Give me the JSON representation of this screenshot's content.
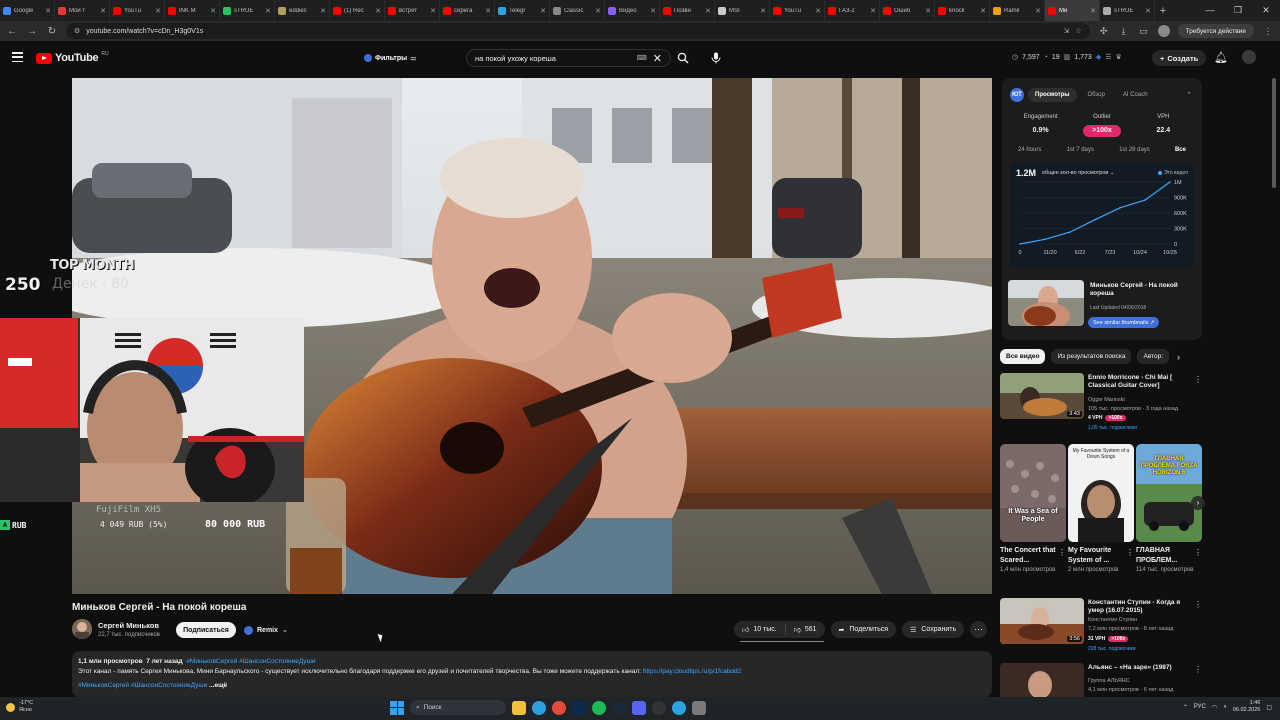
{
  "browser": {
    "tabs": [
      {
        "label": "Google",
        "color": "#4285f4"
      },
      {
        "label": "Мои т",
        "color": "#e53935"
      },
      {
        "label": "YouTu",
        "color": "#ff0000"
      },
      {
        "label": "INK M",
        "color": "#ff0000"
      },
      {
        "label": "sTRUE",
        "color": "#22c55e"
      },
      {
        "label": "eddies",
        "color": "#b0a060"
      },
      {
        "label": "(1) Rec",
        "color": "#ff0000"
      },
      {
        "label": "встрет",
        "color": "#ff0000"
      },
      {
        "label": "серега",
        "color": "#ff0000"
      },
      {
        "label": "Telegr",
        "color": "#2aa3e0"
      },
      {
        "label": "Classic",
        "color": "#888888"
      },
      {
        "label": "Видео",
        "color": "#8b5cf6"
      },
      {
        "label": "Позвн",
        "color": "#ff0000"
      },
      {
        "label": "MSI",
        "color": "#cccccc"
      },
      {
        "label": "YouTu",
        "color": "#ff0000"
      },
      {
        "label": "ГАЗ-2",
        "color": "#ff0000"
      },
      {
        "label": "Ошиб",
        "color": "#ff0000"
      },
      {
        "label": "knock",
        "color": "#ff0000"
      },
      {
        "label": "Ramil",
        "color": "#f59e0b"
      },
      {
        "label": "Ми",
        "color": "#ff0000",
        "active": true
      },
      {
        "label": "sTRUE",
        "color": "#aaaaaa"
      }
    ],
    "url": "youtube.com/watch?v=cDn_H3g0V1s",
    "update_label": "Требуется действие"
  },
  "header": {
    "logo": "YouTube",
    "logo_country": "RU",
    "filters_label": "Фильтры",
    "search_query": "на покой ухожу кореша",
    "stats": [
      "7,597",
      "19",
      "1,773"
    ],
    "create_label": "Создать"
  },
  "overlay": {
    "top_month": "TOP MONTH",
    "count": "250",
    "faded": "Денек · 80",
    "camera_text": "FujiFilm XH5",
    "rub_left": "RUB",
    "rub_pct": "4 049 RUB (5%)",
    "goal": "80 000 RUB"
  },
  "video": {
    "title": "Миньков Сергей - На покой кореша",
    "channel": "Сергей Миньков",
    "subs": "22,7 тыс. подписчиков",
    "subscribe_label": "Подписаться",
    "remix_label": "Remix",
    "likes": "10 тыс.",
    "dislikes": "561",
    "share_label": "Поделиться",
    "save_label": "Сохранить"
  },
  "description": {
    "views": "1,1 млн просмотров",
    "age": "7 лет назад",
    "hashtags": "#МиньковСергей #ШансонСостояниеДуши",
    "text": "Этот канал - память Сергея Минькова, Мини Барнаульского - существует исключительно благодаря поддержке его друзей и почитателей творчества. Вы тоже можете поддержать канал:",
    "link": "https://pay.cloudtips.ru/p/1fcabdd2",
    "hashtags2": "#МиньковСергей #ШансонСостояниеДуши",
    "more": "...ещё"
  },
  "extension": {
    "logo": "ЮТ",
    "tabs": [
      "Просмотры",
      "Обзор",
      "AI Coach"
    ],
    "metrics": [
      {
        "label": "Engagement",
        "value": "0.9%"
      },
      {
        "label": "Outlier",
        "value": ">100x"
      },
      {
        "label": "VPH",
        "value": "22.4"
      }
    ],
    "periods": [
      "24 hours",
      "1st 7 days",
      "1st 28 days",
      "Все"
    ],
    "total": "1.2M",
    "selector": "общее кол-во просмотров ⌄",
    "legend": "Это видео",
    "video_title": "Миньков Сергей - На покой кореша",
    "last_updated": "Last Updated 04/06/2018",
    "similar_btn": "See similar thumbnails ↗"
  },
  "chart_data": {
    "type": "line",
    "x": [
      "0",
      "11/20",
      "6/22",
      "7/23",
      "10/24",
      "10/25"
    ],
    "y_ticks": [
      "1M",
      "900K",
      "600K",
      "300K",
      "0"
    ],
    "values": [
      0,
      90,
      230,
      470,
      700,
      850,
      1200
    ],
    "series": [
      {
        "name": "Это видео",
        "values": [
          0,
          90,
          230,
          470,
          700,
          850,
          1200
        ]
      }
    ],
    "ylim": [
      0,
      1200
    ],
    "color": "#3ea6ff"
  },
  "related": {
    "chips": [
      "Все видео",
      "Из результатов поиска",
      "Автор: "
    ],
    "items": [
      {
        "title": "Ennio Morricone - Chi Mai [ Classical Guitar Cover]",
        "channel": "Oggie Marinski",
        "meta": "105 тыс. просмотров · 3 года назад",
        "vph": "4 VPH",
        "outlier": ">100x",
        "subs": "1,05 тыс. подписчики",
        "dur": "3:43"
      },
      {
        "title": "Константин Ступин - Когда я умер (16.07.2015)",
        "channel": "Константин Ступин",
        "meta": "7,2 млн просмотров · 8 лет назад",
        "vph": "31 VPH",
        "outlier": ">100x",
        "subs": "228 тыс. подписчики",
        "dur": "3:56"
      },
      {
        "title": "Альянс – «На заре» (1987)",
        "channel": "Группа АЛЬЯНС",
        "meta": "4,1 млн просмотров · 6 лет назад",
        "vph": "",
        "outlier": "",
        "subs": "",
        "dur": ""
      }
    ],
    "shorts": [
      {
        "title": "The Concert that Scared...",
        "views": "1,4 млн просмотров",
        "caption": "It Was a Sea of People"
      },
      {
        "title": "My Favourite System of ...",
        "views": "2 млн просмотров",
        "caption": "My Favourite System of a Down Songs"
      },
      {
        "title": "ГЛАВНАЯ ПРОБЛЕМ...",
        "views": "114 тыс. просмотров",
        "caption": "ГЛАВНАЯ ПРОБЛЕМА FORZA HORIZON 6"
      }
    ]
  },
  "taskbar": {
    "weather_temp": "-17°C",
    "weather_text": "Ясно",
    "search_label": "Поиск",
    "lang": "РУС",
    "time": "1:46",
    "date": "06.02.2026"
  }
}
